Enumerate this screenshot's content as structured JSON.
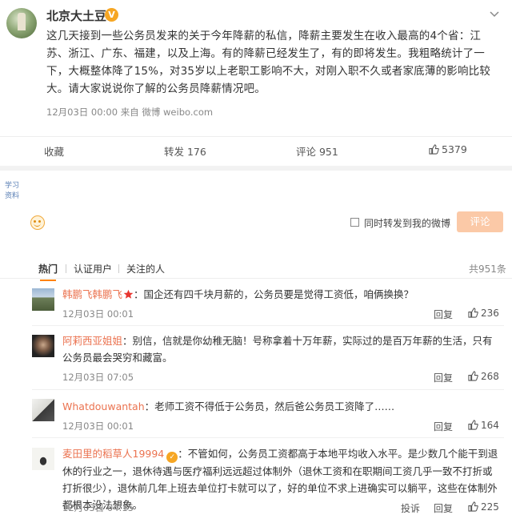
{
  "post": {
    "author": "北京大土豆",
    "verified_badge": "V",
    "text": "这几天接到一些公务员发来的关于今年降薪的私信，降薪主要发生在收入最高的4个省：江苏、浙江、广东、福建，以及上海。有的降薪已经发生了，有的即将发生。我粗略统计了一下，大概整体降了15%，对35岁以上老职工影响不大，对刚入职不久或者家底薄的影响比较大。请大家说说你了解的公务员降薪情况吧。",
    "meta": "12月03日 00:00  来自 微博 weibo.com"
  },
  "actions": {
    "favorite": "收藏",
    "forward": "转发 176",
    "comment": "评论 951",
    "like": "5379"
  },
  "compose": {
    "watermark": "学习资料",
    "checkbox_label": "同时转发到我的微博",
    "submit": "评论"
  },
  "tabs": {
    "hot": "热门",
    "certified": "认证用户",
    "followed": "关注的人",
    "total": "共951条"
  },
  "comments": [
    {
      "name": "韩鹏飞韩鹏飞",
      "text": "：国企还有四千块月薪的，公务员要是觉得工资低，咱俩换换？",
      "time": "12月03日 00:01",
      "reply": "回复",
      "likes": "236"
    },
    {
      "name": "阿莉西亚姐姐",
      "text": "：别信，信就是你幼稚无脑！号称拿着十万年薪，实际过的是百万年薪的生活，只有公务员最会哭穷和藏富。",
      "time": "12月03日 07:05",
      "reply": "回复",
      "likes": "268"
    },
    {
      "name": "Whatdouwantah",
      "text": "：老师工资不得低于公务员，然后爸公务员工资降了……",
      "time": "12月03日 00:01",
      "reply": "回复",
      "likes": "164"
    },
    {
      "name": "麦田里的稻草人19994",
      "text": "：不管如何，公务员工资都高于本地平均收入水平。是少数几个能干到退休的行业之一，退休待遇与医疗福利远远超过体制外（退休工资和在职期间工资几乎一致不打折或打折很少），退休前几年上班去单位打卡就可以了，好的单位不求上进确实可以躺平，这些在体制外都根本没法想象。",
      "time": "12月03日 04:15",
      "report": "投诉",
      "reply": "回复",
      "likes": "225"
    }
  ],
  "colors": {
    "accent": "#ff8200",
    "username": "#eb7350",
    "submit_disabled": "#fbc9a7"
  }
}
